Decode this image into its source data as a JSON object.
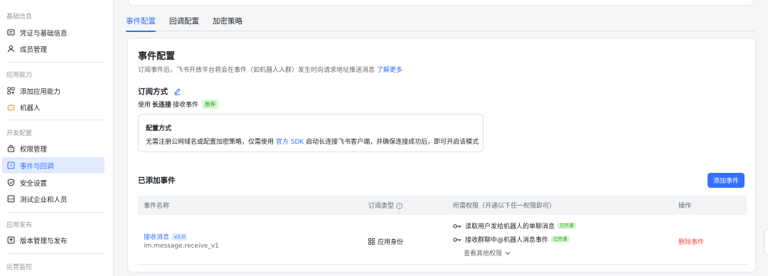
{
  "sidebar": {
    "sections": [
      {
        "title": "基础信息",
        "items": [
          {
            "label": "凭证与基础信息",
            "icon": "id-card-icon"
          },
          {
            "label": "成员管理",
            "icon": "user-icon"
          }
        ]
      },
      {
        "title": "应用能力",
        "items": [
          {
            "label": "添加应用能力",
            "icon": "grid-plus-icon"
          },
          {
            "label": "机器人",
            "icon": "robot-icon"
          }
        ]
      },
      {
        "title": "开发配置",
        "items": [
          {
            "label": "权限管理",
            "icon": "lock-icon"
          },
          {
            "label": "事件与回调",
            "icon": "event-icon",
            "active": true
          },
          {
            "label": "安全设置",
            "icon": "shield-icon"
          },
          {
            "label": "测试企业和人员",
            "icon": "test-icon"
          }
        ]
      },
      {
        "title": "应用发布",
        "items": [
          {
            "label": "版本管理与发布",
            "icon": "upload-icon"
          }
        ]
      },
      {
        "title": "运营监控",
        "items": []
      }
    ]
  },
  "tabs": [
    {
      "label": "事件配置",
      "active": true
    },
    {
      "label": "回调配置",
      "active": false
    },
    {
      "label": "加密策略",
      "active": false
    }
  ],
  "event_config": {
    "title": "事件配置",
    "desc": "订阅事件后，飞书开放平台将会在事件（如机器人入群）发生时向请求地址推送消息",
    "desc_link": "了解更多",
    "sub_title": "订阅方式",
    "use_prefix": "使用",
    "use_mode": "长连接",
    "use_suffix": "接收事件",
    "recommend_tag": "推荐",
    "cfg_title": "配置方式",
    "cfg_desc_a": "无需注册公网域名或配置加密策略，仅需使用",
    "cfg_desc_link": "官方 SDK",
    "cfg_desc_b": "启动长连接飞书客户端，并确保连接成功后，即可开启该模式"
  },
  "added": {
    "title": "已添加事件",
    "add_button": "添加事件",
    "columns": [
      "事件名称",
      "订阅类型",
      "所需权限（开通以下任一权限即可）",
      "操作"
    ],
    "col2_help": "?",
    "rows": [
      {
        "name": "接收消息",
        "version": "v2.0",
        "key": "im.message.receive_v1",
        "sub_type": "应用身份",
        "perms": [
          {
            "label": "读取用户发给机器人的单聊消息",
            "status": "已开通"
          },
          {
            "label": "接收群聊中@机器人消息事件",
            "status": "已开通"
          }
        ],
        "more": "查看其他权限",
        "action": "删除事件"
      }
    ]
  },
  "colors": {
    "accent": "#3370ff",
    "danger": "#f54a45",
    "success": "#2ea121"
  }
}
